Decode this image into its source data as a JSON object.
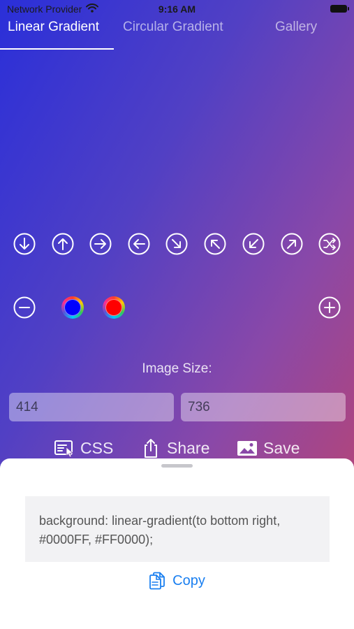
{
  "status_bar": {
    "carrier": "Network Provider",
    "time": "9:16 AM"
  },
  "tabs": [
    {
      "label": "Linear Gradient",
      "active": true
    },
    {
      "label": "Circular Gradient",
      "active": false
    },
    {
      "label": "Gallery",
      "active": false
    }
  ],
  "direction_buttons": [
    {
      "icon": "arrow-down-icon"
    },
    {
      "icon": "arrow-up-icon"
    },
    {
      "icon": "arrow-right-icon"
    },
    {
      "icon": "arrow-left-icon"
    },
    {
      "icon": "arrow-down-right-icon"
    },
    {
      "icon": "arrow-up-left-icon"
    },
    {
      "icon": "arrow-down-left-icon"
    },
    {
      "icon": "arrow-up-right-icon"
    },
    {
      "icon": "shuffle-icon"
    }
  ],
  "color_stops": [
    {
      "color": "#0000FF"
    },
    {
      "color": "#FF0000"
    }
  ],
  "image_size": {
    "label": "Image Size:",
    "width": "414",
    "height": "736"
  },
  "actions": {
    "css_label": "CSS",
    "share_label": "Share",
    "save_label": "Save"
  },
  "sheet": {
    "code_line1": "background: linear-gradient(to bottom right,",
    "code_line2": "#0000FF, #FF0000);",
    "copy_label": "Copy"
  },
  "colors": {
    "accent": "#1a7ff0",
    "gradient_start": "#0000FF",
    "gradient_end": "#FF0000"
  }
}
